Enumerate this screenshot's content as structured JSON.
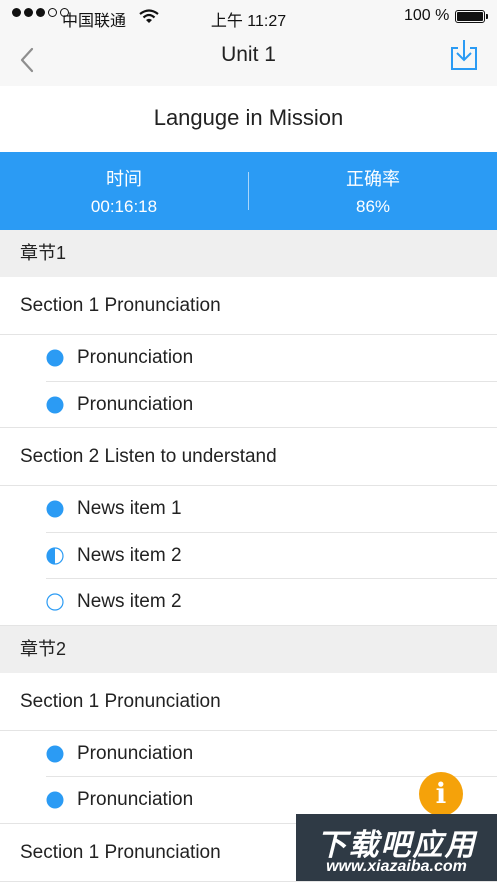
{
  "status_bar": {
    "carrier": "中国联通",
    "time": "上午 11:27",
    "battery": "100 %"
  },
  "nav": {
    "title": "Unit 1",
    "back_icon": "chevron-left-icon",
    "download_icon": "download-icon"
  },
  "header": {
    "title": "Languge in Mission"
  },
  "stats": {
    "time_label": "时间",
    "time_value": "00:16:18",
    "accuracy_label": "正确率",
    "accuracy_value": "86%"
  },
  "chapters": [
    {
      "title": "章节1",
      "sections": [
        {
          "title": "Section 1 Pronunciation",
          "items": [
            {
              "label": "Pronunciation",
              "status": "complete"
            },
            {
              "label": "Pronunciation",
              "status": "complete"
            }
          ]
        },
        {
          "title": "Section 2 Listen to understand",
          "items": [
            {
              "label": "News item 1",
              "status": "complete"
            },
            {
              "label": "News item 2",
              "status": "half"
            },
            {
              "label": "News item 2",
              "status": "empty"
            }
          ]
        }
      ]
    },
    {
      "title": "章节2",
      "sections": [
        {
          "title": "Section 1 Pronunciation",
          "items": [
            {
              "label": "Pronunciation",
              "status": "complete"
            },
            {
              "label": "Pronunciation",
              "status": "complete"
            }
          ]
        },
        {
          "title": "Section 1 Pronunciation",
          "items": []
        }
      ]
    }
  ],
  "info_button": {
    "label": "i",
    "color": "#f5a20a"
  },
  "watermark": {
    "title": "下载吧应用",
    "url": "www.xiazaiba.com"
  },
  "colors": {
    "accent": "#2b9bf4",
    "chapter_bg": "#efefef"
  }
}
